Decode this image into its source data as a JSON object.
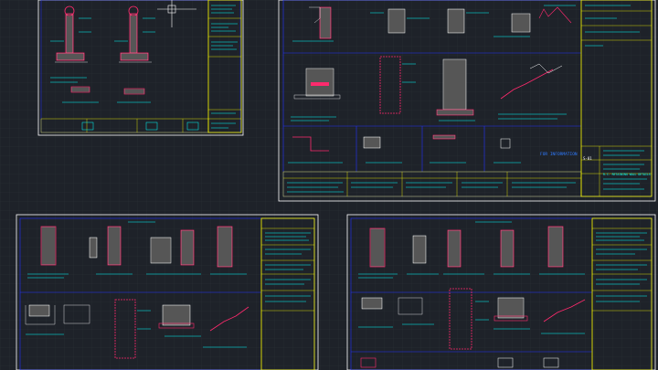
{
  "sheets": [
    {
      "id": "sheet-top-left"
    },
    {
      "id": "sheet-top-right",
      "stamp": "FOR INFORMATION",
      "title": "R.C. RETAINING WALL DETAILS"
    },
    {
      "id": "sheet-bottom-left"
    },
    {
      "id": "sheet-bottom-right"
    }
  ],
  "colors": {
    "background": "#1e2229",
    "grid": "#2a2f38",
    "sheet_border": "#ffffff",
    "frame": "#2233ff",
    "title_block": "#ffff00",
    "annotation": "#00ffff",
    "section": "#ff2a6d",
    "hatch": "#c8c8c8",
    "label_green": "#33ff33"
  }
}
